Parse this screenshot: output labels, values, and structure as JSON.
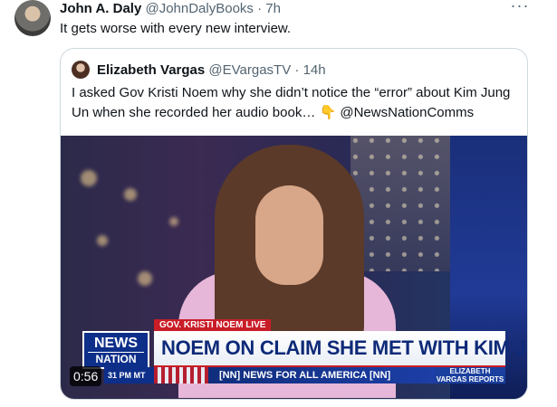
{
  "tweet": {
    "author_name": "John A. Daly",
    "handle": "@JohnDalyBooks",
    "separator": "·",
    "time": "7h",
    "more_label": "···",
    "text": "It gets worse with every new interview."
  },
  "quoted_tweet": {
    "author_name": "Elizabeth Vargas",
    "handle": "@EVargasTV",
    "separator": "·",
    "time": "14h",
    "text_part1": "I asked Gov Kristi Noem why she didn’t notice the “error” about Kim Jung Un when she recorded her audio book… ",
    "emoji": "👇",
    "text_part2": " @NewsNationComms"
  },
  "video": {
    "lower_third_tag": "GOV. KRISTI NOEM LIVE",
    "headline": "NOEM ON CLAIM SHE MET WITH KIM JONG UN",
    "logo_top": "NEWS",
    "logo_bottom": "NATION",
    "ticker": "[NN] NEWS FOR ALL AMERICA [NN]",
    "time_fragment": "31 PM MT",
    "show_line1": "ELIZABETH",
    "show_line2": "VARGAS REPORTS",
    "duration": "0:56"
  }
}
